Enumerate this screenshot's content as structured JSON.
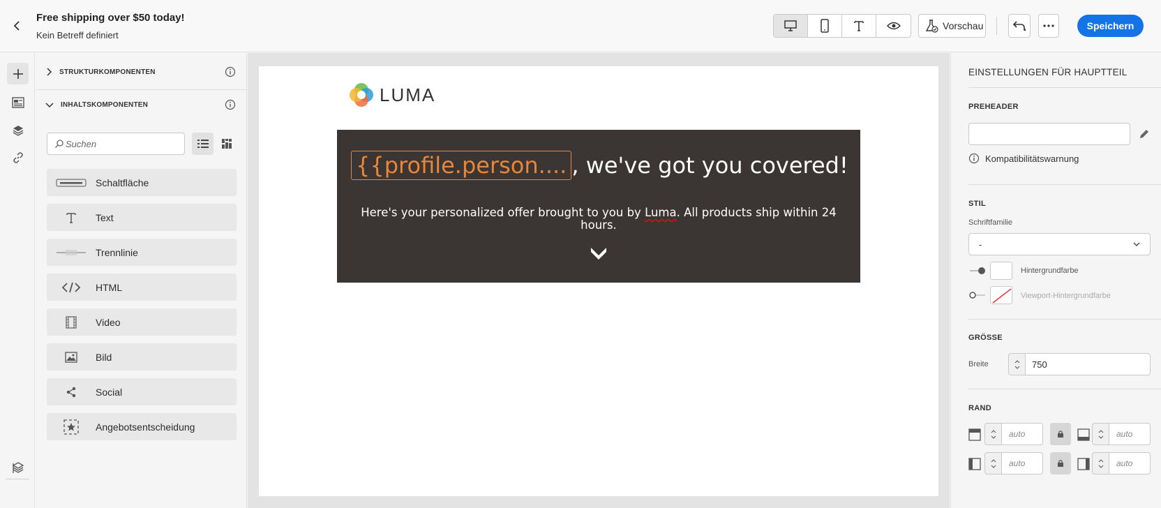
{
  "header": {
    "title": "Free shipping over $50 today!",
    "subtitle": "Kein Betreff definiert",
    "preview_label": "Vorschau",
    "save_label": "Speichern"
  },
  "panel": {
    "structure_section": "STRUKTURKOMPONENTEN",
    "content_section": "INHALTSKOMPONENTEN",
    "search_placeholder": "Suchen",
    "components": [
      {
        "label": "Schaltfläche",
        "icon": "button-icon"
      },
      {
        "label": "Text",
        "icon": "text-icon"
      },
      {
        "label": "Trennlinie",
        "icon": "divider-icon"
      },
      {
        "label": "HTML",
        "icon": "code-icon"
      },
      {
        "label": "Video",
        "icon": "film-icon"
      },
      {
        "label": "Bild",
        "icon": "image-icon"
      },
      {
        "label": "Social",
        "icon": "share-icon"
      },
      {
        "label": "Angebotsentscheidung",
        "icon": "offer-icon"
      }
    ]
  },
  "email": {
    "logo_text": "LUMA",
    "token": "{{profile.person....",
    "heading_rest": ", we've got you covered!",
    "body_before": "Here's your personalized offer brought to you by ",
    "body_brand": "Luma",
    "body_after": ". All products ship within 24 hours."
  },
  "settings": {
    "title": "EINSTELLUNGEN FÜR HAUPTTEIL",
    "preheader_label": "PREHEADER",
    "preheader_value": "",
    "compat_warning": "Kompatibilitätswarnung",
    "style_label": "STIL",
    "font_family_label": "Schriftfamilie",
    "font_family_value": "-",
    "bg_color_label": "Hintergrundfarbe",
    "viewport_bg_label": "Viewport-Hintergrundfarbe",
    "size_label": "GRÖSSE",
    "width_label": "Breite",
    "width_value": "750",
    "margin_label": "RAND",
    "margin_top": "auto",
    "margin_bottom": "auto",
    "margin_left": "auto",
    "margin_right": "auto"
  },
  "colors": {
    "accent": "#1473e6",
    "token": "#e8863a",
    "hero_bg": "#3b3533"
  }
}
